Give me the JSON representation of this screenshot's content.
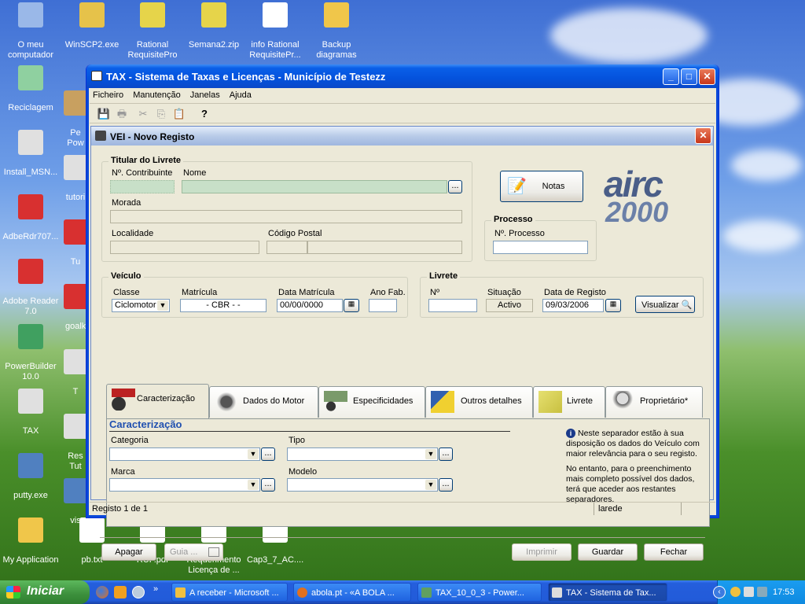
{
  "desktop": {
    "icons": [
      {
        "label": "O meu computador",
        "color": "#9ab8e8"
      },
      {
        "label": "WinSCP2.exe",
        "color": "#e6c24a"
      },
      {
        "label": "Rational RequisitePro",
        "color": "#e6d44a"
      },
      {
        "label": "Semana2.zip",
        "color": "#e6d44a"
      },
      {
        "label": "info Rational RequisitePr...",
        "color": "#ffffff"
      },
      {
        "label": "Backup diagramas",
        "color": "#f0c64a"
      },
      {
        "label": "Reciclagem",
        "color": "#8fd0a0"
      },
      {
        "label": "Pe Pow",
        "color": "#c8a060"
      },
      {
        "label": "Install_MSN...",
        "color": "#e0e0e0"
      },
      {
        "label": "tutori",
        "color": "#e0e0e0"
      },
      {
        "label": "AdbeRdr707...",
        "color": "#d83030"
      },
      {
        "label": "Tu",
        "color": "#d83030"
      },
      {
        "label": "Adobe Reader 7.0",
        "color": "#d83030"
      },
      {
        "label": "goalk",
        "color": "#d83030"
      },
      {
        "label": "PowerBuilder 10.0",
        "color": "#40a060"
      },
      {
        "label": "T",
        "color": "#e0e0e0"
      },
      {
        "label": "TAX",
        "color": "#e0e0e0"
      },
      {
        "label": "Res Tut",
        "color": "#e0e0e0"
      },
      {
        "label": "putty.exe",
        "color": "#5080c0"
      },
      {
        "label": "vis",
        "color": "#5080c0"
      },
      {
        "label": "My Application",
        "color": "#f0c64a"
      },
      {
        "label": "pb.txt",
        "color": "#ffffff"
      },
      {
        "label": "RUP.pdf",
        "color": "#ffffff"
      },
      {
        "label": "Requerimento Licença de ...",
        "color": "#ffffff"
      },
      {
        "label": "Cap3_7_AC....",
        "color": "#ffffff"
      }
    ]
  },
  "window": {
    "title": "TAX - Sistema de Taxas e Licenças - Município de Testezz",
    "menu": [
      "Ficheiro",
      "Manutenção",
      "Janelas",
      "Ajuda"
    ],
    "toolbar": [
      {
        "icon": "save-icon",
        "glyph": "💾"
      },
      {
        "icon": "print-icon",
        "glyph": "🖶"
      },
      {
        "icon": "cut-icon",
        "glyph": "✂"
      },
      {
        "icon": "copy-icon",
        "glyph": "⎘"
      },
      {
        "icon": "paste-icon",
        "glyph": "📋"
      },
      {
        "icon": "help-icon",
        "glyph": "?"
      }
    ],
    "status": {
      "records": "Registo 1 de 1",
      "user": "larede"
    }
  },
  "dialog": {
    "title": "VEI - Novo Registo",
    "titular": {
      "title": "Titular do Livrete",
      "contribuinte_label": "Nº. Contribuinte",
      "nome_label": "Nome",
      "morada_label": "Morada",
      "localidade_label": "Localidade",
      "codpostal_label": "Código Postal",
      "browse": "..."
    },
    "notas": "Notas",
    "processo": {
      "title": "Processo",
      "label": "Nº. Processo"
    },
    "logo": {
      "line1": "airc",
      "line2": "2000"
    },
    "veiculo": {
      "title": "Veículo",
      "classe_label": "Classe",
      "classe_value": "Ciclomotor",
      "matricula_label": "Matrícula",
      "matricula_value": "- CBR -        -",
      "datamat_label": "Data Matrícula",
      "datamat_value": "00/00/0000",
      "anofab_label": "Ano Fab."
    },
    "livrete": {
      "title": "Livrete",
      "n_label": "Nº",
      "situacao_label": "Situação",
      "situacao_value": "Activo",
      "dataregisto_label": "Data de Registo",
      "dataregisto_value": "09/03/2006",
      "visualizar": "Visualizar"
    },
    "tabs": [
      {
        "label": "Caracterização",
        "icon": "vehicle-icon"
      },
      {
        "label": "Dados do Motor",
        "icon": "engine-icon"
      },
      {
        "label": "Especificidades",
        "icon": "scooter-icon"
      },
      {
        "label": "Outros detalhes",
        "icon": "details-icon"
      },
      {
        "label": "Livrete",
        "icon": "booklet-icon"
      },
      {
        "label": "Proprietário*",
        "icon": "person-icon"
      }
    ],
    "carac": {
      "title": "Caracterização",
      "categoria": "Categoria",
      "tipo": "Tipo",
      "marca": "Marca",
      "modelo": "Modelo",
      "info1": "Neste separador estão à sua disposição os dados do Veículo com maior relevância para o seu registo.",
      "info2": "No entanto, para o preenchimento mais completo possível dos dados, terá que aceder aos restantes separadores."
    },
    "buttons": {
      "apagar": "Apagar",
      "guia": "Guia ...",
      "imprimir": "Imprimir",
      "guardar": "Guardar",
      "fechar": "Fechar"
    }
  },
  "taskbar": {
    "start": "Iniciar",
    "tasks": [
      "A receber - Microsoft ...",
      "abola.pt - «A BOLA ...",
      "TAX_10_0_3 - Power...",
      "TAX - Sistema de Tax..."
    ],
    "time": "17:53"
  }
}
